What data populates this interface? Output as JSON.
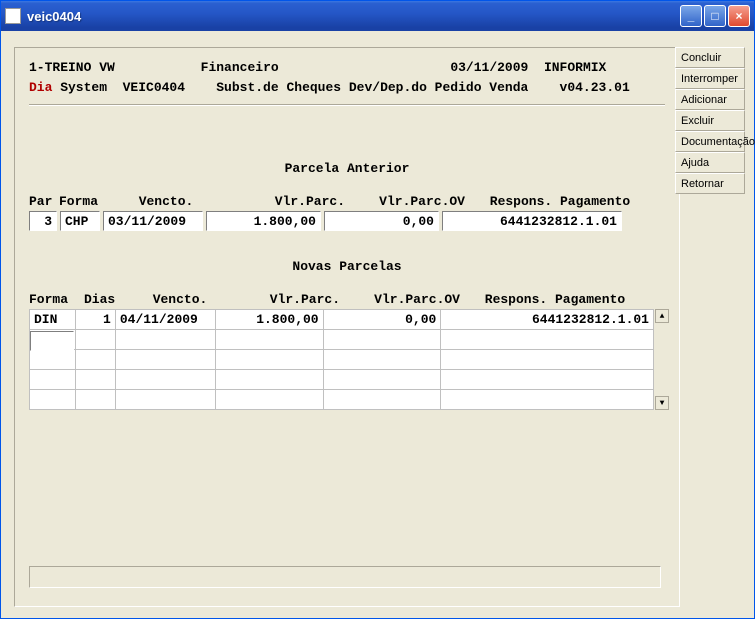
{
  "window": {
    "title": "veic0404"
  },
  "header": {
    "line1_left": "1-TREINO VW",
    "line1_mid": "Financeiro",
    "line1_date": "03/11/2009",
    "line1_db": "INFORMIX",
    "line2_prefix": "Dia",
    "line2_system": " System  VEIC0404",
    "line2_desc": "Subst.de Cheques Dev/Dep.do Pedido Venda",
    "line2_ver": "v04.23.01"
  },
  "sections": {
    "anterior_title": "Parcela Anterior",
    "novas_title": "Novas Parcelas"
  },
  "anterior_cols": {
    "par": "Par",
    "forma": "Forma",
    "venc": "Vencto.",
    "vlr": "Vlr.Parc.",
    "vlrov": "Vlr.Parc.OV",
    "resp": "Respons. Pagamento"
  },
  "anterior_row": {
    "par": "3",
    "forma": "CHP",
    "venc": "03/11/2009",
    "vlr": "1.800,00",
    "vlrov": "0,00",
    "resp": "6441232812.1.01"
  },
  "novas_cols": {
    "forma": "Forma",
    "dias": "Dias",
    "venc": "Vencto.",
    "vlr": "Vlr.Parc.",
    "vlrov": "Vlr.Parc.OV",
    "resp": "Respons. Pagamento"
  },
  "novas_rows": [
    {
      "forma": "DIN",
      "dias": "1",
      "venc": "04/11/2009",
      "vlr": "1.800,00",
      "vlrov": "0,00",
      "resp": "6441232812.1.01"
    }
  ],
  "buttons": {
    "concluir": "Concluir",
    "interromper": "Interromper",
    "adicionar": "Adicionar",
    "excluir": "Excluir",
    "documentacao": "Documentação",
    "ajuda": "Ajuda",
    "retornar": "Retornar"
  }
}
